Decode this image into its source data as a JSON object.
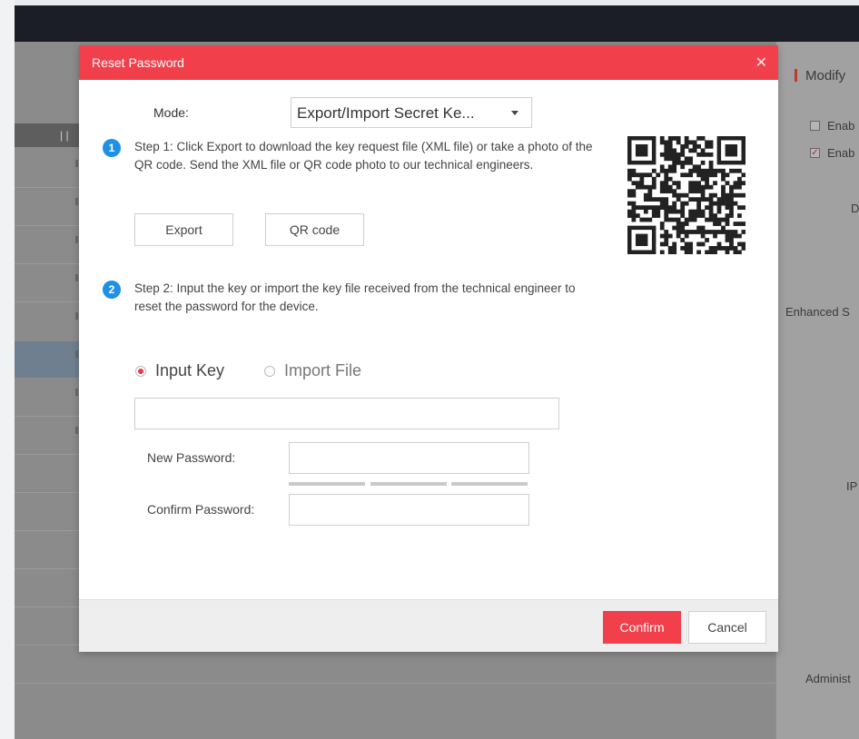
{
  "background": {
    "list_header_text": "| |",
    "right_panel": {
      "title": "Modify",
      "checkbox_1_label": "Enab",
      "checkbox_2_label": "Enab",
      "label_d": "D",
      "label_enhanced": "Enhanced S",
      "label_ip": "IP",
      "label_admin": "Administ"
    }
  },
  "dialog": {
    "title": "Reset Password",
    "close_icon": "close-icon",
    "mode_label": "Mode:",
    "mode_value": "Export/Import Secret Ke...",
    "step1": {
      "number": "1",
      "text": "Step 1: Click Export to download the key request file (XML file) or take a photo of the QR code. Send the XML file or QR code photo to our technical engineers."
    },
    "export_label": "Export",
    "qr_code_label": "QR code",
    "step2": {
      "number": "2",
      "text": "Step 2: Input the key or import the key file received from the technical engineer to reset the password for the device."
    },
    "radio_input_key": "Input Key",
    "radio_import_file": "Import File",
    "key_input_value": "",
    "new_password_label": "New Password:",
    "new_password_value": "",
    "confirm_password_label": "Confirm Password:",
    "confirm_password_value": "",
    "confirm_label": "Confirm",
    "cancel_label": "Cancel"
  },
  "colors": {
    "accent_red": "#f1404b",
    "step_blue": "#1e90e6",
    "topbar": "#1b1e27"
  }
}
